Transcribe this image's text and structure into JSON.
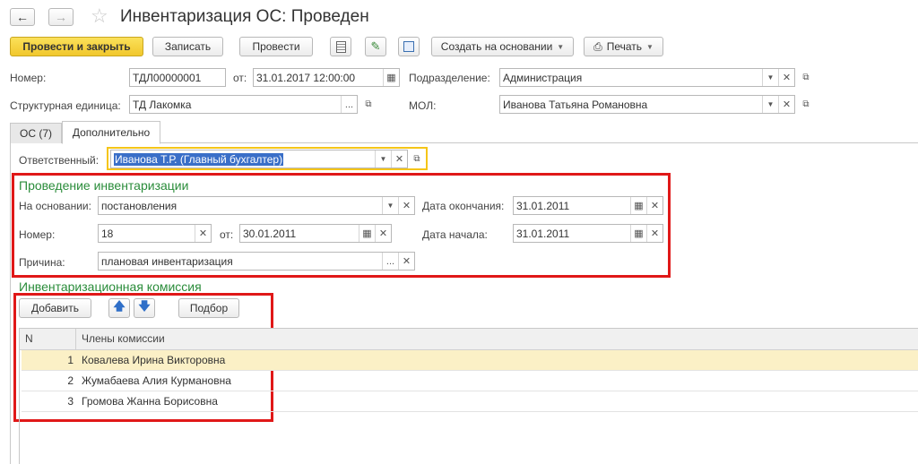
{
  "header": {
    "title": "Инвентаризация ОС: Проведен"
  },
  "toolbar": {
    "post_close": "Провести и закрыть",
    "save": "Записать",
    "post": "Провести",
    "create_based": "Создать на основании",
    "print": "Печать"
  },
  "form": {
    "number_label": "Номер:",
    "number_value": "ТДЛ00000001",
    "from_label": "от:",
    "date_value": "31.01.2017 12:00:00",
    "division_label": "Подразделение:",
    "division_value": "Администрация",
    "unit_label": "Структурная единица:",
    "unit_value": "ТД Лакомка",
    "mol_label": "МОЛ:",
    "mol_value": "Иванова Татьяна Романовна"
  },
  "tabs": [
    {
      "label": "ОС (7)"
    },
    {
      "label": "Дополнительно"
    }
  ],
  "responsible": {
    "label": "Ответственный:",
    "value": "Иванова Т.Р. (Главный бухгалтер)"
  },
  "inventory": {
    "title": "Проведение инвентаризации",
    "basis_label": "На основании:",
    "basis_value": "постановления",
    "end_label": "Дата окончания:",
    "end_value": "31.01.2011",
    "number_label": "Номер:",
    "number_value": "18",
    "from_label": "от:",
    "from_value": "30.01.2011",
    "start_label": "Дата начала:",
    "start_value": "31.01.2011",
    "reason_label": "Причина:",
    "reason_value": "плановая инвентаризация"
  },
  "commission": {
    "title": "Инвентаризационная комиссия",
    "add_button": "Добавить",
    "select_button": "Подбор",
    "col_n": "N",
    "col_members": "Члены комиссии",
    "rows": [
      {
        "n": "1",
        "name": "Ковалева Ирина Викторовна"
      },
      {
        "n": "2",
        "name": "Жумабаева Алия Курмановна"
      },
      {
        "n": "3",
        "name": "Громова Жанна Борисовна"
      }
    ]
  },
  "colors": {
    "accent_yellow": "#f1c72c",
    "highlight_red": "#e01818",
    "section_green": "#2a8c3a",
    "row_selected": "#fbf0c6"
  }
}
